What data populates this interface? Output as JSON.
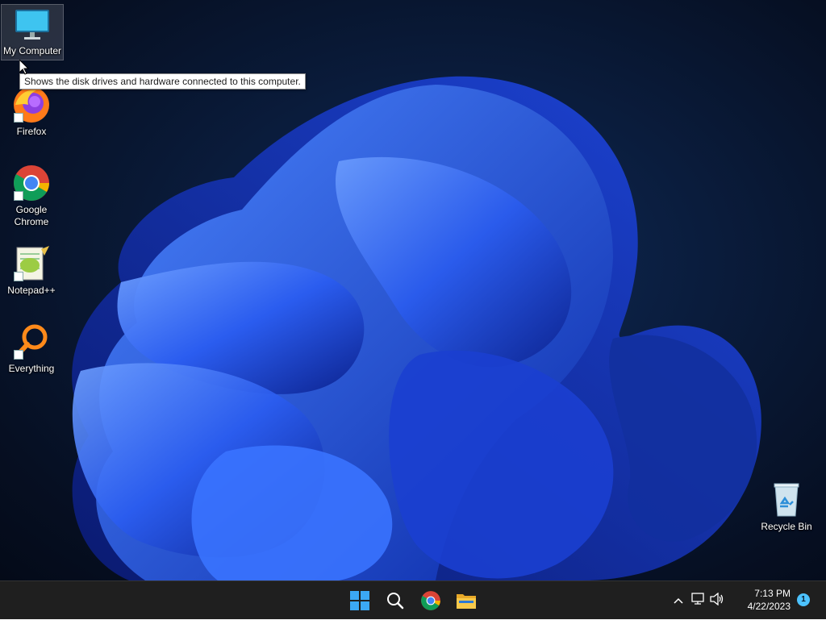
{
  "desktop": {
    "icons": [
      {
        "label": "My Computer",
        "icon": "monitor-icon"
      },
      {
        "label": "Firefox",
        "icon": "firefox-icon"
      },
      {
        "label": "Google Chrome",
        "icon": "chrome-icon"
      },
      {
        "label": "Notepad++",
        "icon": "notepadpp-icon"
      },
      {
        "label": "Everything",
        "icon": "everything-icon"
      },
      {
        "label": "Recycle Bin",
        "icon": "recycle-bin-icon"
      }
    ],
    "tooltip": "Shows the disk drives and hardware connected to this computer."
  },
  "taskbar": {
    "pinned": [
      {
        "icon": "windows-start-icon"
      },
      {
        "icon": "search-icon"
      },
      {
        "icon": "chrome-icon"
      },
      {
        "icon": "file-explorer-icon"
      }
    ],
    "tray": {
      "chevron": "chevron-up-icon",
      "network": "network-icon",
      "volume": "volume-icon"
    },
    "clock": {
      "time": "7:13 PM",
      "date": "4/22/2023"
    },
    "notification_count": "1"
  },
  "colors": {
    "accent": "#2f6cff",
    "taskbar": "#1f1f1f"
  }
}
